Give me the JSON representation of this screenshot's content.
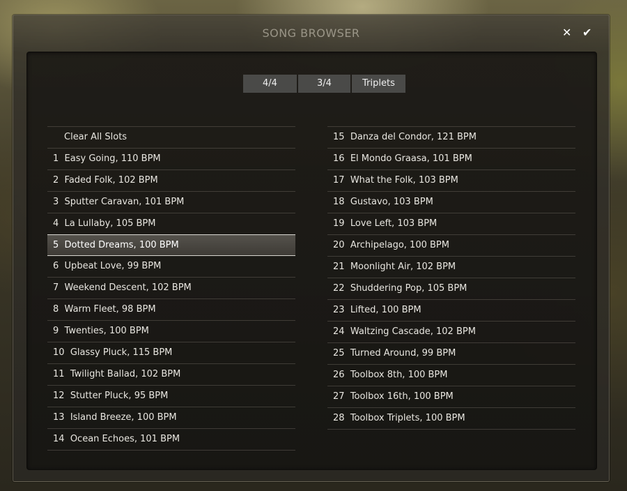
{
  "window": {
    "title": "SONG BROWSER",
    "close_icon": "close-icon",
    "confirm_icon": "check-icon"
  },
  "tabs": [
    "4/4",
    "3/4",
    "Triplets"
  ],
  "clear_label": "Clear All Slots",
  "selected_slot": 5,
  "left_songs": [
    {
      "n": "1",
      "label": "Easy Going, 110 BPM"
    },
    {
      "n": "2",
      "label": "Faded Folk, 102 BPM"
    },
    {
      "n": "3",
      "label": "Sputter Caravan, 101 BPM"
    },
    {
      "n": "4",
      "label": "La Lullaby, 105 BPM"
    },
    {
      "n": "5",
      "label": "Dotted Dreams, 100 BPM"
    },
    {
      "n": "6",
      "label": "Upbeat Love, 99 BPM"
    },
    {
      "n": "7",
      "label": "Weekend Descent, 102 BPM"
    },
    {
      "n": "8",
      "label": "Warm Fleet, 98 BPM"
    },
    {
      "n": "9",
      "label": "Twenties, 100 BPM"
    },
    {
      "n": "10",
      "label": "Glassy Pluck, 115 BPM"
    },
    {
      "n": "11",
      "label": "Twilight Ballad, 102 BPM"
    },
    {
      "n": "12",
      "label": "Stutter Pluck, 95 BPM"
    },
    {
      "n": "13",
      "label": "Island Breeze, 100 BPM"
    },
    {
      "n": "14",
      "label": "Ocean Echoes, 101 BPM"
    }
  ],
  "right_songs": [
    {
      "n": "15",
      "label": "Danza del Condor, 121 BPM"
    },
    {
      "n": "16",
      "label": "El Mondo Graasa, 101 BPM"
    },
    {
      "n": "17",
      "label": "What the Folk, 103 BPM"
    },
    {
      "n": "18",
      "label": "Gustavo, 103 BPM"
    },
    {
      "n": "19",
      "label": "Love Left, 103 BPM"
    },
    {
      "n": "20",
      "label": "Archipelago, 100 BPM"
    },
    {
      "n": "21",
      "label": "Moonlight Air, 102 BPM"
    },
    {
      "n": "22",
      "label": "Shuddering Pop, 105 BPM"
    },
    {
      "n": "23",
      "label": "Lifted, 100 BPM"
    },
    {
      "n": "24",
      "label": "Waltzing Cascade, 102 BPM"
    },
    {
      "n": "25",
      "label": "Turned Around, 99 BPM"
    },
    {
      "n": "26",
      "label": "Toolbox 8th, 100 BPM"
    },
    {
      "n": "27",
      "label": "Toolbox 16th, 100 BPM"
    },
    {
      "n": "28",
      "label": "Toolbox Triplets, 100 BPM"
    }
  ]
}
